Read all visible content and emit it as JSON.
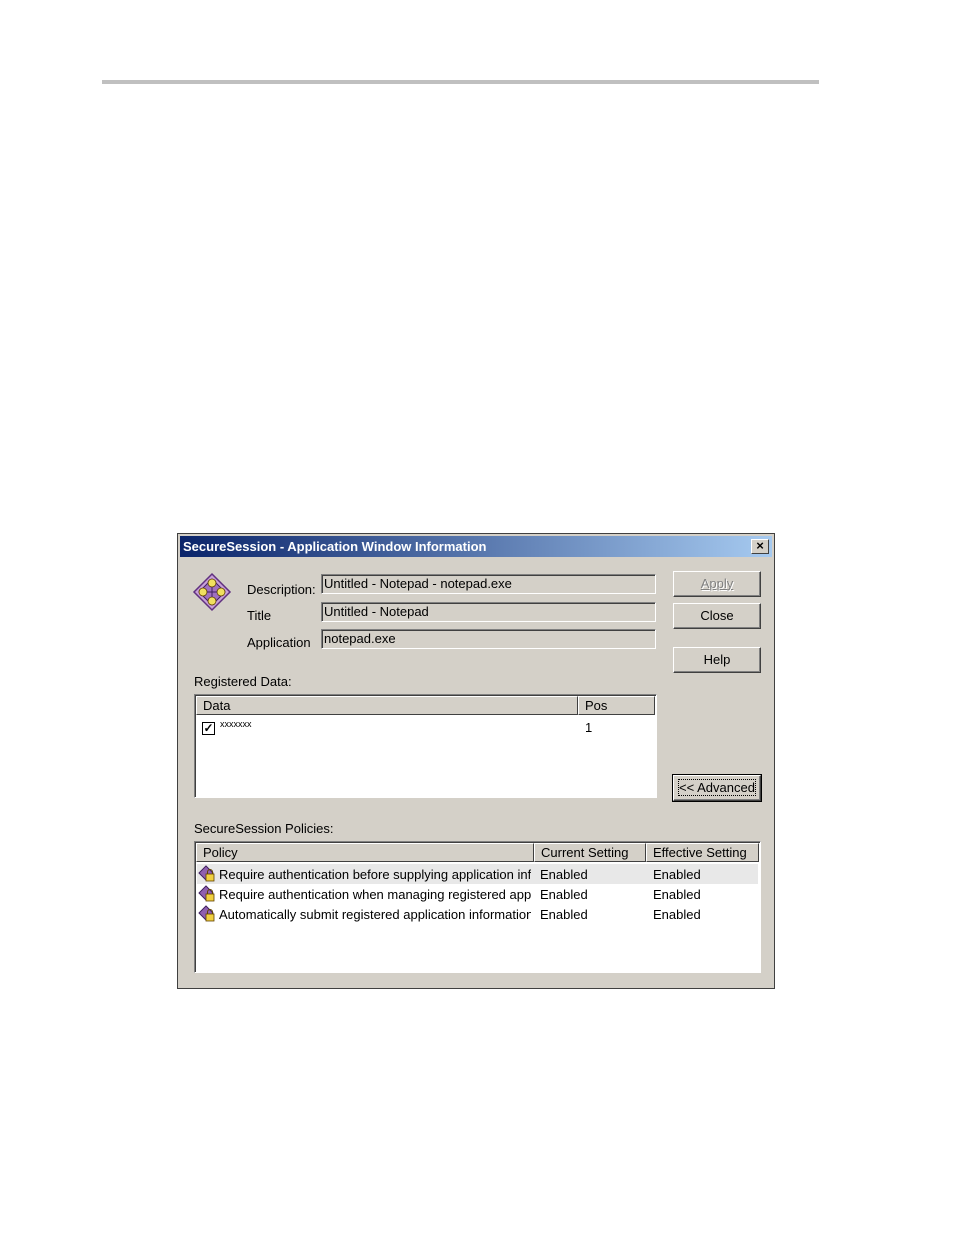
{
  "dialog": {
    "title": "SecureSession - Application Window Information",
    "close_glyph": "×"
  },
  "fields": {
    "description_label": "Description:",
    "description_value": "Untitled - Notepad - notepad.exe",
    "title_label": "Title",
    "title_value": "Untitled - Notepad",
    "application_label": "Application",
    "application_value": "notepad.exe"
  },
  "buttons": {
    "apply": "Apply",
    "close": "Close",
    "help": "Help",
    "advanced": "<< Advanced"
  },
  "registered_data": {
    "label": "Registered Data:",
    "columns": [
      "Data",
      "Pos"
    ],
    "rows": [
      {
        "checked": true,
        "data": "xxxxxxx",
        "pos": "1"
      }
    ]
  },
  "policies": {
    "label": "SecureSession Policies:",
    "columns": [
      "Policy",
      "Current Setting",
      "Effective Setting"
    ],
    "rows": [
      {
        "policy": "Require authentication before supplying application inf...",
        "current": "Enabled",
        "effective": "Enabled"
      },
      {
        "policy": "Require authentication when managing registered appl...",
        "current": "Enabled",
        "effective": "Enabled"
      },
      {
        "policy": "Automatically submit registered application information",
        "current": "Enabled",
        "effective": "Enabled"
      }
    ]
  },
  "colors": {
    "titlebar_start": "#0a246a",
    "titlebar_end": "#a6caf0",
    "dialog_face": "#d4d0c8"
  },
  "icons": {
    "app": "diamond-network-icon",
    "policy": "policy-lock-icon",
    "checkbox": "checkbox-checked-icon"
  }
}
